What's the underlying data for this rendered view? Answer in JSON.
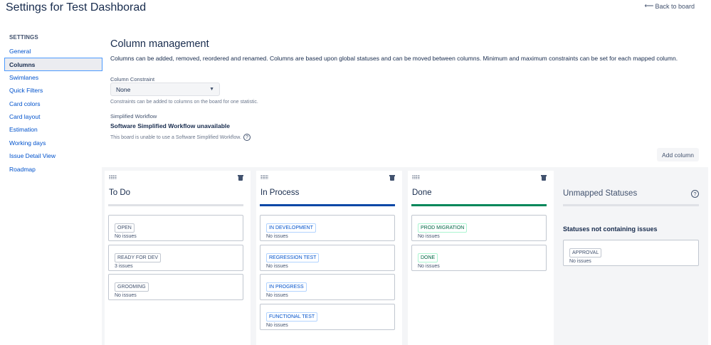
{
  "header": {
    "title": "Settings for Test Dashborad",
    "back_link": "Back to board"
  },
  "sidebar": {
    "heading": "SETTINGS",
    "items": [
      {
        "label": "General"
      },
      {
        "label": "Columns",
        "active": true
      },
      {
        "label": "Swimlanes"
      },
      {
        "label": "Quick Filters"
      },
      {
        "label": "Card colors"
      },
      {
        "label": "Card layout"
      },
      {
        "label": "Estimation"
      },
      {
        "label": "Working days"
      },
      {
        "label": "Issue Detail View"
      },
      {
        "label": "Roadmap"
      }
    ]
  },
  "main": {
    "title": "Column management",
    "description": "Columns can be added, removed, reordered and renamed. Columns are based upon global statuses and can be moved between columns. Minimum and maximum constraints can be set for each mapped column.",
    "constraint": {
      "label": "Column Constraint",
      "selected": "None",
      "help": "Constraints can be added to columns on the board for one statistic."
    },
    "workflow": {
      "label": "Simplified Workflow",
      "title": "Software Simplified Workflow unavailable",
      "help": "This board is unable to use a Software Simplified Workflow."
    },
    "add_column_label": "Add column"
  },
  "columns": [
    {
      "title": "To Do",
      "statuses": [
        {
          "name": "OPEN",
          "count": "No issues"
        },
        {
          "name": "READY FOR DEV",
          "count": "3 issues"
        },
        {
          "name": "GROOMING",
          "count": "No issues"
        }
      ]
    },
    {
      "title": "In Process",
      "statuses": [
        {
          "name": "IN DEVELOPMENT",
          "count": "No issues"
        },
        {
          "name": "REGRESSION TEST",
          "count": "No issues"
        },
        {
          "name": "IN PROGRESS",
          "count": "No issues"
        },
        {
          "name": "FUNCTIONAL TEST",
          "count": "No issues"
        }
      ]
    },
    {
      "title": "Done",
      "statuses": [
        {
          "name": "PROD MIGRATION",
          "count": "No issues"
        },
        {
          "name": "DONE",
          "count": "No issues"
        }
      ]
    }
  ],
  "unmapped": {
    "title": "Unmapped Statuses",
    "subtitle": "Statuses not containing issues",
    "statuses": [
      {
        "name": "APPROVAL",
        "count": "No issues"
      }
    ]
  },
  "colors": {
    "accent": "#0052cc",
    "in_process_bar": "#0747a6",
    "done_bar": "#00875a",
    "board_bg": "#f4f5f7"
  },
  "icons": {
    "back": "left-arrow-icon",
    "help": "question-circle-icon",
    "delete": "trash-icon",
    "drag": "drag-handle-icon",
    "select": "chevron-down-icon"
  }
}
